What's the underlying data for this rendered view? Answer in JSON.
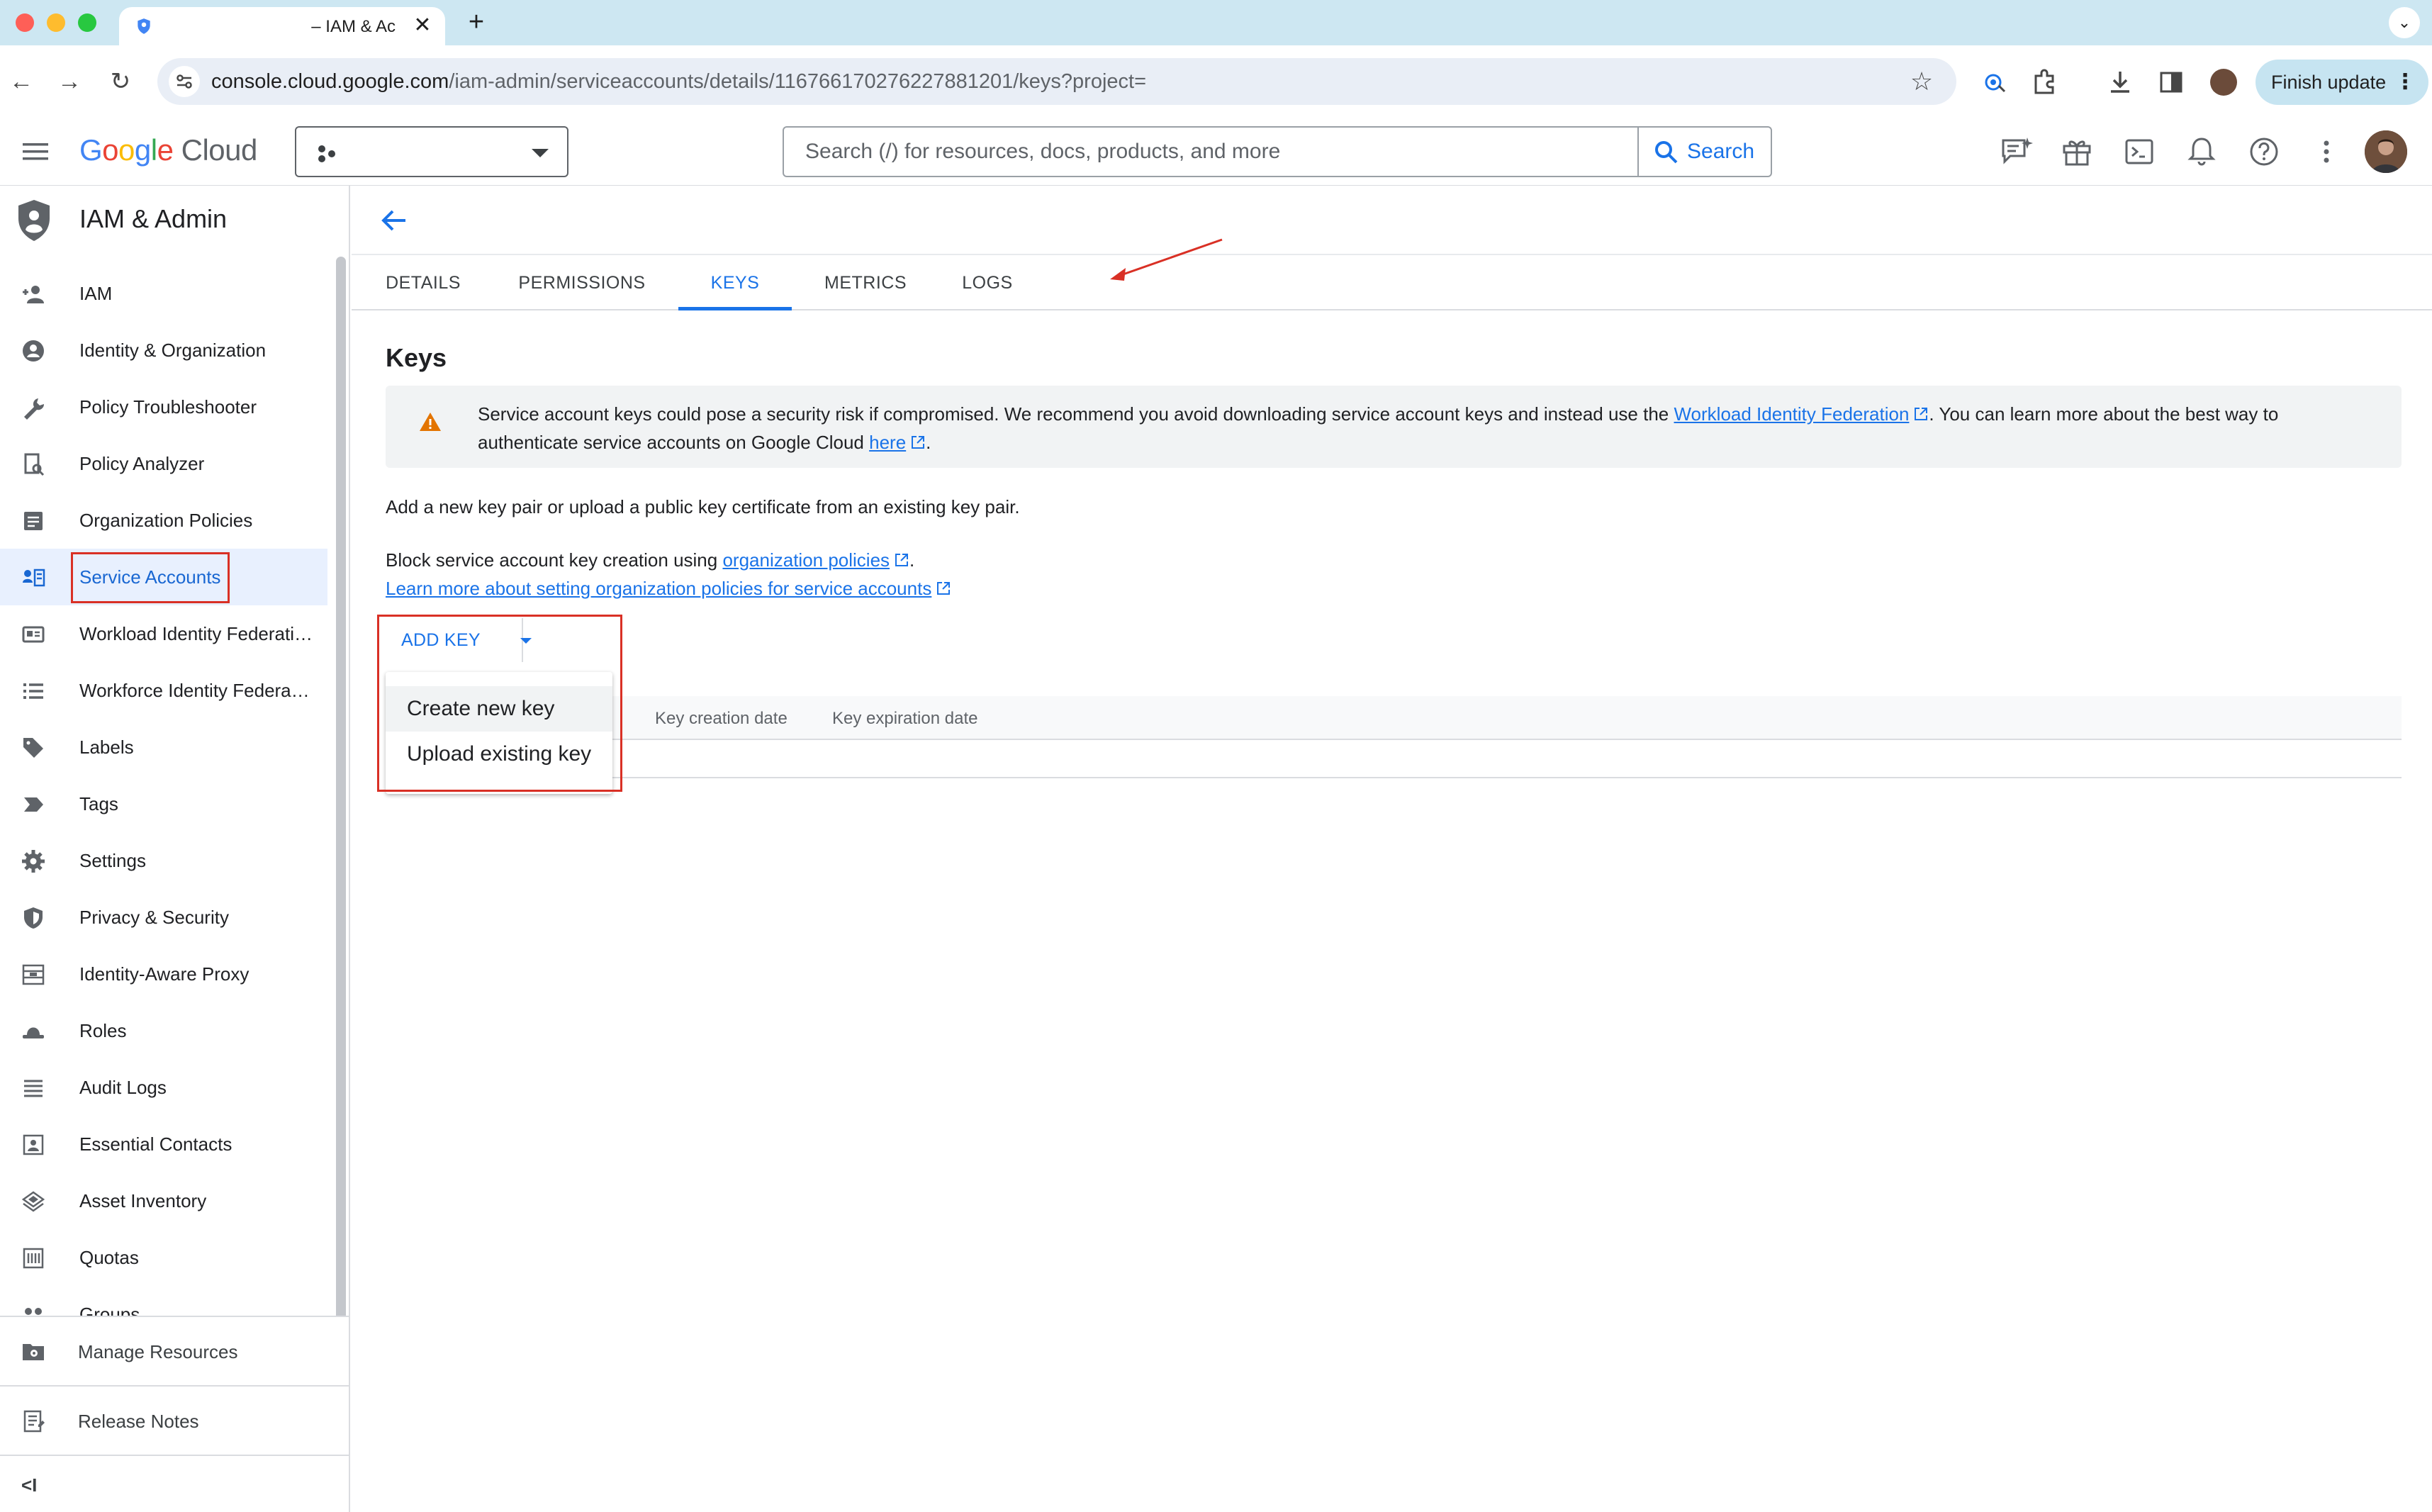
{
  "browser": {
    "tab_title": "– IAM & Ac",
    "tab_close": "✕",
    "new_tab": "+",
    "tab_menu": "⌄",
    "url_host": "console.cloud.google.com",
    "url_path": "/iam-admin/serviceaccounts/details/116766170276227881201/keys?project=",
    "finish_update": "Finish update",
    "update_menu": "⋮",
    "back": "←",
    "forward": "→",
    "reload": "↻",
    "star": "☆"
  },
  "gcp_bar": {
    "logo_google": [
      "G",
      "o",
      "o",
      "g",
      "l",
      "e"
    ],
    "logo_cloud": "Cloud",
    "search_placeholder": "Search (/) for resources, docs, products, and more",
    "search_button": "Search",
    "icons": [
      "chat-spark-icon",
      "gift-icon",
      "cloud-shell-icon",
      "bell-icon",
      "help-icon",
      "more-vert-icon"
    ]
  },
  "sidebar": {
    "title": "IAM & Admin",
    "items": [
      {
        "label": "IAM",
        "icon": "person-add-icon"
      },
      {
        "label": "Identity & Organization",
        "icon": "account-circle-icon"
      },
      {
        "label": "Policy Troubleshooter",
        "icon": "wrench-icon"
      },
      {
        "label": "Policy Analyzer",
        "icon": "policy-doc-icon"
      },
      {
        "label": "Organization Policies",
        "icon": "document-list-icon"
      },
      {
        "label": "Service Accounts",
        "icon": "service-account-icon"
      },
      {
        "label": "Workload Identity Federation",
        "icon": "id-card-icon"
      },
      {
        "label": "Workforce Identity Federation",
        "icon": "list-icon"
      },
      {
        "label": "Labels",
        "icon": "label-icon"
      },
      {
        "label": "Tags",
        "icon": "tag-arrow-icon"
      },
      {
        "label": "Settings",
        "icon": "gear-icon"
      },
      {
        "label": "Privacy & Security",
        "icon": "shield-icon"
      },
      {
        "label": "Identity-Aware Proxy",
        "icon": "proxy-icon"
      },
      {
        "label": "Roles",
        "icon": "hat-icon"
      },
      {
        "label": "Audit Logs",
        "icon": "lines-icon"
      },
      {
        "label": "Essential Contacts",
        "icon": "contact-card-icon"
      },
      {
        "label": "Asset Inventory",
        "icon": "layers-icon"
      },
      {
        "label": "Quotas",
        "icon": "quota-icon"
      },
      {
        "label": "Groups",
        "icon": "groups-icon"
      }
    ],
    "active_index": 5,
    "footer": [
      {
        "label": "Manage Resources",
        "icon": "folder-gear-icon"
      },
      {
        "label": "Release Notes",
        "icon": "notes-icon"
      }
    ],
    "collapse": "<I"
  },
  "main": {
    "tabs": [
      "DETAILS",
      "PERMISSIONS",
      "KEYS",
      "METRICS",
      "LOGS"
    ],
    "active_tab": 2,
    "section_title": "Keys",
    "warning": {
      "text_before": "Service account keys could pose a security risk if compromised. We recommend you avoid downloading service account keys and instead use the ",
      "link1": "Workload Identity Federation",
      "text_middle": ". You can learn more about the best way to authenticate service accounts on Google Cloud ",
      "link2": "here",
      "text_after": "."
    },
    "para1": "Add a new key pair or upload a public key certificate from an existing key pair.",
    "para2_before": "Block service account key creation using ",
    "para2_link": "organization policies",
    "para2_after": ".",
    "para3_link": "Learn more about setting organization policies for service accounts",
    "add_key_label": "ADD KEY",
    "table_headers": [
      "Key creation date",
      "Key expiration date"
    ],
    "dropdown": [
      "Create new key",
      "Upload existing key"
    ]
  },
  "colors": {
    "accent": "#1a73e8",
    "annotation": "#d93025",
    "warning": "#e37400"
  }
}
